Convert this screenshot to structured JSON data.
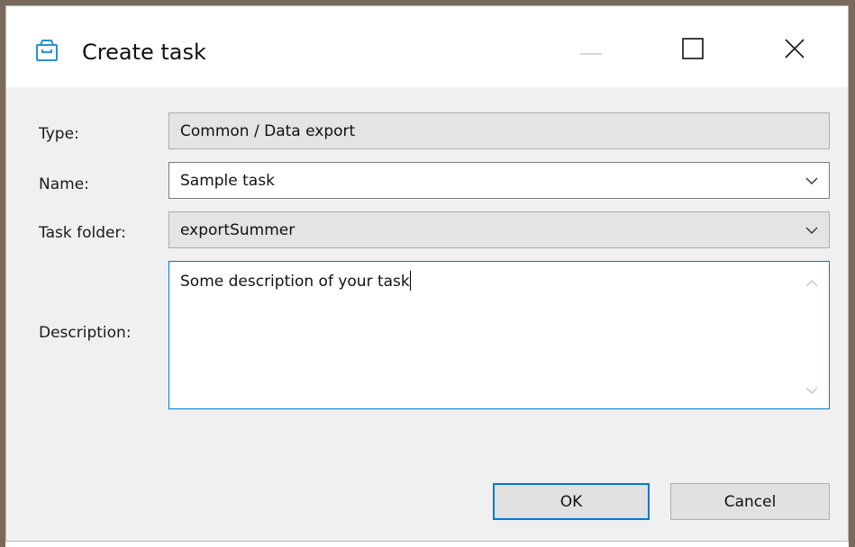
{
  "window": {
    "title": "Create task",
    "icon": "task-box-icon",
    "controls": [
      "minimize-icon",
      "maximize-icon",
      "close-icon"
    ]
  },
  "form": {
    "type_label": "Type:",
    "type_value": "Common / Data export",
    "name_label": "Name:",
    "name_value": "Sample task",
    "folder_label": "Task folder:",
    "folder_value": "exportSummer",
    "description_label": "Description:",
    "description_value": "Some description of your task"
  },
  "buttons": {
    "ok_label": "OK",
    "cancel_label": "Cancel"
  },
  "colors": {
    "accent": "#0078d7",
    "icon": "#2b8fd6",
    "frame": "#7a6a5c"
  }
}
